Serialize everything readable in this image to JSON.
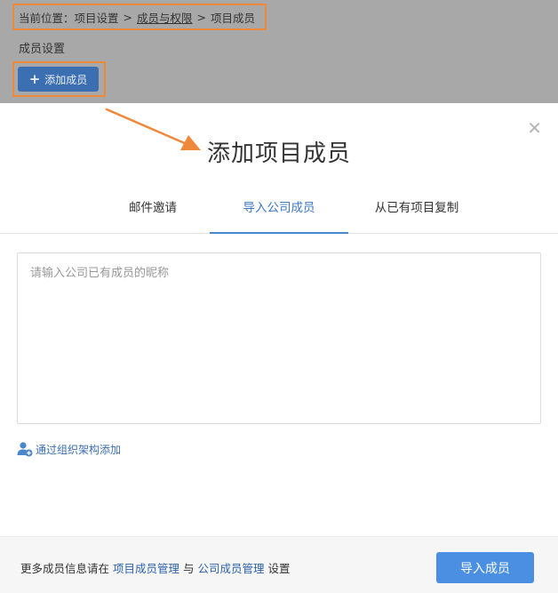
{
  "breadcrumb": {
    "prefix": "当前位置：",
    "items": [
      "项目设置",
      "成员与权限",
      "项目成员"
    ],
    "separator": ">"
  },
  "section_title": "成员设置",
  "add_button_label": "添加成员",
  "modal": {
    "title": "添加项目成员",
    "close_icon": "close-icon",
    "tabs": [
      {
        "label": "邮件邀请",
        "active": false
      },
      {
        "label": "导入公司成员",
        "active": true
      },
      {
        "label": "从已有项目复制",
        "active": false
      }
    ],
    "input_placeholder": "请输入公司已有成员的昵称",
    "org_link_label": "通过组织架构添加",
    "footer": {
      "text_before": "更多成员信息请在",
      "link1": "项目成员管理",
      "text_mid": "与",
      "link2": "公司成员管理",
      "text_after": "设置",
      "import_button_label": "导入成员"
    }
  },
  "colors": {
    "annotation": "#f0883a",
    "accent": "#4a86cc",
    "primary_button": "#4a8fe2",
    "overlay": "#a8a8a8"
  }
}
